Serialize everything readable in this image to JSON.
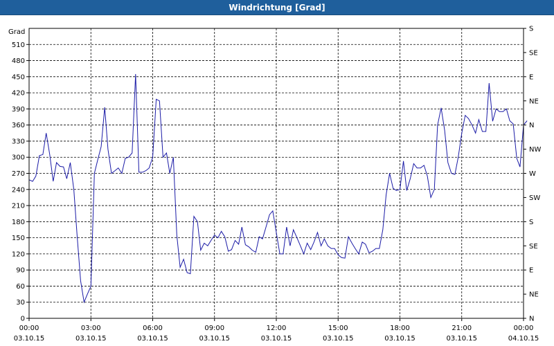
{
  "window": {
    "title": "Windrichtung [Grad]"
  },
  "chart_data": {
    "type": "line",
    "title": "Windrichtung [Grad]",
    "ylabel": "Grad",
    "xlabel": "",
    "ylim": [
      0,
      540
    ],
    "y_ticks": [
      0,
      30,
      60,
      90,
      120,
      150,
      180,
      210,
      240,
      270,
      300,
      330,
      360,
      390,
      420,
      450,
      480,
      510
    ],
    "y_right_ticks": [
      {
        "value": 0,
        "label": "N"
      },
      {
        "value": 45,
        "label": "NE"
      },
      {
        "value": 90,
        "label": "E"
      },
      {
        "value": 135,
        "label": "SE"
      },
      {
        "value": 180,
        "label": "S"
      },
      {
        "value": 225,
        "label": "SW"
      },
      {
        "value": 270,
        "label": "W"
      },
      {
        "value": 315,
        "label": "NW"
      },
      {
        "value": 360,
        "label": "N"
      },
      {
        "value": 405,
        "label": "NE"
      },
      {
        "value": 450,
        "label": "E"
      },
      {
        "value": 495,
        "label": "SE"
      },
      {
        "value": 540,
        "label": "S"
      }
    ],
    "xlim": [
      0,
      24
    ],
    "x_ticks": [
      {
        "hour": 0,
        "time": "00:00",
        "date": "03.10.15"
      },
      {
        "hour": 3,
        "time": "03:00",
        "date": "03.10.15"
      },
      {
        "hour": 6,
        "time": "06:00",
        "date": "03.10.15"
      },
      {
        "hour": 9,
        "time": "09:00",
        "date": "03.10.15"
      },
      {
        "hour": 12,
        "time": "12:00",
        "date": "03.10.15"
      },
      {
        "hour": 15,
        "time": "15:00",
        "date": "03.10.15"
      },
      {
        "hour": 18,
        "time": "18:00",
        "date": "03.10.15"
      },
      {
        "hour": 21,
        "time": "21:00",
        "date": "03.10.15"
      },
      {
        "hour": 24,
        "time": "00:00",
        "date": "04.10.15"
      }
    ],
    "grid": true,
    "series": [
      {
        "color": "#1a1aa6",
        "points": [
          [
            0.0,
            258
          ],
          [
            0.17,
            255
          ],
          [
            0.33,
            265
          ],
          [
            0.5,
            303
          ],
          [
            0.67,
            305
          ],
          [
            0.83,
            345
          ],
          [
            1.0,
            305
          ],
          [
            1.17,
            255
          ],
          [
            1.33,
            290
          ],
          [
            1.5,
            283
          ],
          [
            1.67,
            282
          ],
          [
            1.83,
            260
          ],
          [
            2.0,
            290
          ],
          [
            2.17,
            240
          ],
          [
            2.33,
            155
          ],
          [
            2.5,
            70
          ],
          [
            2.67,
            30
          ],
          [
            2.83,
            45
          ],
          [
            3.0,
            60
          ],
          [
            3.17,
            270
          ],
          [
            3.33,
            295
          ],
          [
            3.5,
            320
          ],
          [
            3.67,
            393
          ],
          [
            3.83,
            315
          ],
          [
            4.0,
            270
          ],
          [
            4.17,
            275
          ],
          [
            4.33,
            280
          ],
          [
            4.5,
            270
          ],
          [
            4.67,
            298
          ],
          [
            4.83,
            300
          ],
          [
            5.0,
            308
          ],
          [
            5.17,
            455
          ],
          [
            5.33,
            272
          ],
          [
            5.5,
            272
          ],
          [
            5.67,
            275
          ],
          [
            5.83,
            280
          ],
          [
            6.0,
            300
          ],
          [
            6.17,
            408
          ],
          [
            6.33,
            405
          ],
          [
            6.5,
            300
          ],
          [
            6.67,
            308
          ],
          [
            6.83,
            270
          ],
          [
            7.0,
            300
          ],
          [
            7.17,
            155
          ],
          [
            7.33,
            95
          ],
          [
            7.5,
            110
          ],
          [
            7.67,
            85
          ],
          [
            7.83,
            83
          ],
          [
            8.0,
            190
          ],
          [
            8.17,
            180
          ],
          [
            8.33,
            127
          ],
          [
            8.5,
            140
          ],
          [
            8.67,
            135
          ],
          [
            8.83,
            145
          ],
          [
            9.0,
            155
          ],
          [
            9.17,
            150
          ],
          [
            9.33,
            162
          ],
          [
            9.5,
            152
          ],
          [
            9.67,
            125
          ],
          [
            9.83,
            128
          ],
          [
            10.0,
            145
          ],
          [
            10.17,
            138
          ],
          [
            10.33,
            170
          ],
          [
            10.5,
            137
          ],
          [
            10.67,
            133
          ],
          [
            10.83,
            127
          ],
          [
            11.0,
            123
          ],
          [
            11.17,
            152
          ],
          [
            11.33,
            148
          ],
          [
            11.5,
            170
          ],
          [
            11.67,
            193
          ],
          [
            11.83,
            200
          ],
          [
            12.0,
            160
          ],
          [
            12.17,
            120
          ],
          [
            12.33,
            120
          ],
          [
            12.5,
            170
          ],
          [
            12.67,
            135
          ],
          [
            12.83,
            165
          ],
          [
            13.0,
            150
          ],
          [
            13.17,
            135
          ],
          [
            13.33,
            120
          ],
          [
            13.5,
            140
          ],
          [
            13.67,
            128
          ],
          [
            13.83,
            142
          ],
          [
            14.0,
            160
          ],
          [
            14.17,
            135
          ],
          [
            14.33,
            148
          ],
          [
            14.5,
            135
          ],
          [
            14.67,
            130
          ],
          [
            14.83,
            130
          ],
          [
            15.0,
            118
          ],
          [
            15.17,
            113
          ],
          [
            15.33,
            112
          ],
          [
            15.5,
            152
          ],
          [
            15.67,
            140
          ],
          [
            15.83,
            130
          ],
          [
            16.0,
            120
          ],
          [
            16.17,
            142
          ],
          [
            16.33,
            138
          ],
          [
            16.5,
            122
          ],
          [
            16.67,
            125
          ],
          [
            16.83,
            130
          ],
          [
            17.0,
            130
          ],
          [
            17.17,
            165
          ],
          [
            17.33,
            230
          ],
          [
            17.5,
            270
          ],
          [
            17.67,
            242
          ],
          [
            17.83,
            238
          ],
          [
            18.0,
            240
          ],
          [
            18.17,
            293
          ],
          [
            18.33,
            238
          ],
          [
            18.5,
            260
          ],
          [
            18.67,
            288
          ],
          [
            18.83,
            280
          ],
          [
            19.0,
            280
          ],
          [
            19.17,
            285
          ],
          [
            19.33,
            265
          ],
          [
            19.5,
            225
          ],
          [
            19.67,
            240
          ],
          [
            19.83,
            360
          ],
          [
            20.0,
            392
          ],
          [
            20.17,
            350
          ],
          [
            20.33,
            290
          ],
          [
            20.5,
            270
          ],
          [
            20.67,
            268
          ],
          [
            20.83,
            300
          ],
          [
            21.0,
            345
          ],
          [
            21.17,
            378
          ],
          [
            21.33,
            372
          ],
          [
            21.5,
            360
          ],
          [
            21.67,
            345
          ],
          [
            21.83,
            370
          ],
          [
            22.0,
            348
          ],
          [
            22.17,
            348
          ],
          [
            22.33,
            438
          ],
          [
            22.5,
            367
          ],
          [
            22.67,
            390
          ],
          [
            22.83,
            385
          ],
          [
            23.0,
            385
          ],
          [
            23.17,
            390
          ],
          [
            23.33,
            368
          ],
          [
            23.5,
            362
          ],
          [
            23.67,
            298
          ],
          [
            23.83,
            282
          ],
          [
            24.0,
            360
          ],
          [
            24.17,
            368
          ]
        ]
      }
    ]
  }
}
